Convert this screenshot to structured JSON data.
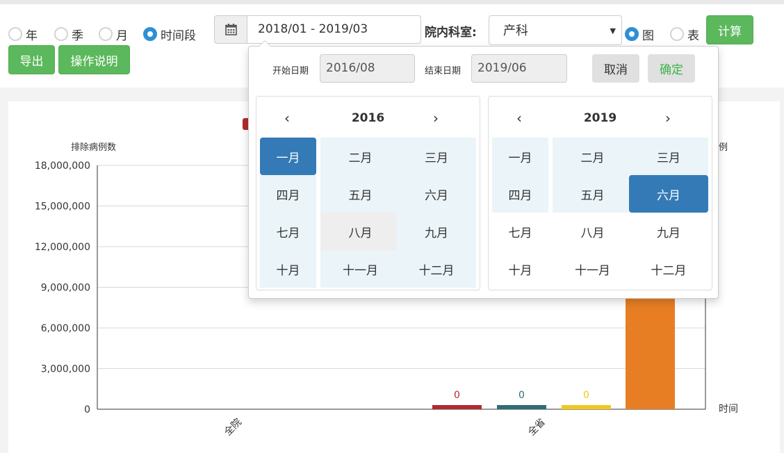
{
  "period_options": [
    {
      "label": "年",
      "checked": false
    },
    {
      "label": "季",
      "checked": false
    },
    {
      "label": "月",
      "checked": false
    },
    {
      "label": "时间段",
      "checked": true
    }
  ],
  "date_range": {
    "value": "2018/01 - 2019/03",
    "icon": "calendar-icon"
  },
  "department": {
    "label": "院内科室:",
    "value": "产科"
  },
  "view_options": [
    {
      "label": "图",
      "checked": true
    },
    {
      "label": "表",
      "checked": false
    }
  ],
  "buttons": {
    "calculate": "计算",
    "export": "导出",
    "help": "操作说明"
  },
  "colors": {
    "accent_green": "#5cb85c",
    "radio_blue": "#2f8fd6",
    "selected_blue": "#337ab7",
    "range_bg": "#ebf4f8",
    "confirm_text": "#3cb44b"
  },
  "datepicker": {
    "start_label": "开始日期",
    "start_value": "2016/08",
    "end_label": "结束日期",
    "end_value": "2019/06",
    "cancel": "取消",
    "confirm": "确定",
    "prev_icon": "‹",
    "next_icon": "›",
    "left_calendar": {
      "year": "2016",
      "selected": "一月",
      "highlight": "八月"
    },
    "right_calendar": {
      "year": "2019",
      "selected": "六月"
    },
    "months": [
      "一月",
      "二月",
      "三月",
      "四月",
      "五月",
      "六月",
      "七月",
      "八月",
      "九月",
      "十月",
      "十一月",
      "十二月"
    ]
  },
  "chart_data": {
    "type": "bar",
    "ylabel": "排除病例数",
    "y2label_partial": "例",
    "xlabel": "时间",
    "categories": [
      "全院",
      "全省"
    ],
    "ylim": [
      0,
      18000000
    ],
    "yticks": [
      "18,000,000",
      "15,000,000",
      "12,000,000",
      "9,000,000",
      "6,000,000",
      "3,000,000",
      "0"
    ],
    "series": [
      {
        "color": "#b22a2e",
        "values": [
          null,
          0
        ],
        "label": "0"
      },
      {
        "color": "#2f6e74",
        "values": [
          null,
          0
        ],
        "label": "0"
      },
      {
        "color": "#f2c81e",
        "values": [
          null,
          0
        ],
        "label": "0"
      },
      {
        "color": "#e87e24",
        "values": [
          null,
          null
        ],
        "label": ""
      }
    ],
    "grid": true
  }
}
